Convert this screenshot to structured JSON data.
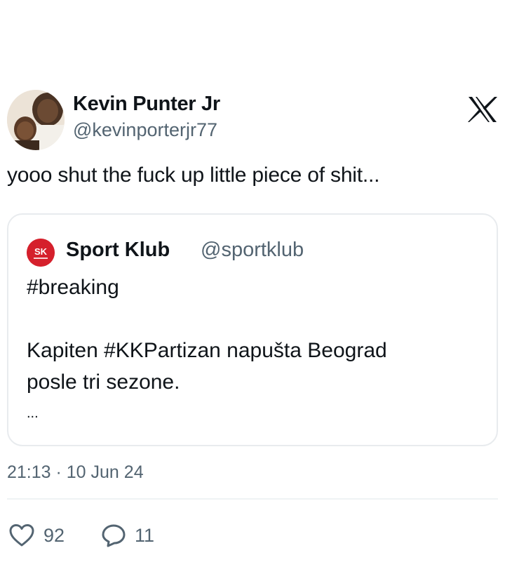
{
  "tweet": {
    "author_name": "Kevin Punter Jr",
    "author_handle": "@kevinporterjr77",
    "text": "yooo shut the fuck up little piece of shit...",
    "timestamp": "21:13 · 10 Jun 24",
    "platform_icon": "x-logo-icon"
  },
  "quote": {
    "author_name": "Sport Klub",
    "author_handle": "@sportklub",
    "avatar_text": "SK",
    "hashtag": "#breaking",
    "line1": "Kapiten #KKPartizan napušta Beograd",
    "line2": "posle tri sezone.",
    "ellipsis": "...",
    "avatar_color": "#d5202c"
  },
  "actions": {
    "likes": "92",
    "replies": "11",
    "like_icon": "heart-icon",
    "reply_icon": "reply-bubble-icon"
  }
}
